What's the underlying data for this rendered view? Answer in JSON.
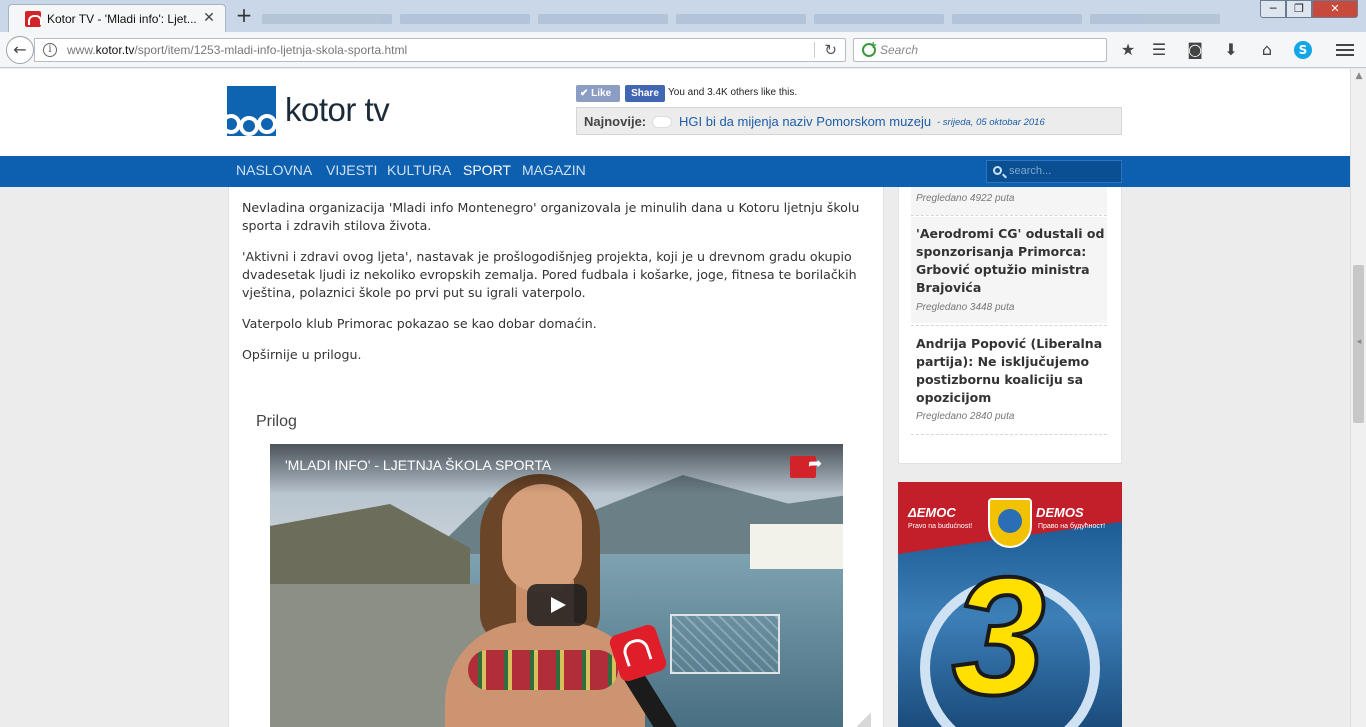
{
  "browser": {
    "tab_title": "Kotor TV - 'Mladi info': Ljet...",
    "tab_close": "✕",
    "new_tab": "+",
    "url_domain_prefix": "www.",
    "url_domain": "kotor.tv",
    "url_path": "/sport/item/1253-mladi-info-ljetnja-skola-sporta.html",
    "search_placeholder": "Search",
    "window_min": "─",
    "window_max": "❐",
    "window_close": "✕",
    "back_icon": "←",
    "info_icon": "i",
    "reload_icon": "↻",
    "toolbar_icons": [
      "★",
      "☰",
      "◙",
      "⬇",
      "⌂",
      "S"
    ]
  },
  "header": {
    "logo_text": "kotor tv",
    "fb_like": "✔ Like",
    "fb_share": "Share",
    "fb_count": "You and 3.4K others like this.",
    "ticker_label": "Najnovije:",
    "ticker_link": "HGI bi da mijenja naziv Pomorskom muzeju",
    "ticker_date": "-  srijeda, 05 oktobar 2016"
  },
  "nav": {
    "items": [
      "NASLOVNA",
      "VIJESTI",
      "KULTURA",
      "SPORT",
      "MAGAZIN"
    ],
    "active": "SPORT",
    "search_placeholder": "search..."
  },
  "article": {
    "paragraphs": [
      "Nevladina organizacija 'Mladi info Montenegro' organizovala je minulih dana u Kotoru ljetnju školu sporta i zdravih stilova života.",
      "'Aktivni i zdravi ovog ljeta', nastavak je prošlogodišnjeg projekta, koji je u drevnom gradu okupio dvadesetak ljudi iz nekoliko evropskih zemalja. Pored fudbala i košarke, joge, fitnesa te borilačkih vještina, polaznici škole po prvi put su igrali vaterpolo.",
      "Vaterpolo klub Primorac pokazao se kao dobar domaćin.",
      "Opširnije u prilogu."
    ],
    "attachment_heading": "Prilog",
    "video_title": "'MLADI INFO' - LJETNJA ŠKOLA SPORTA"
  },
  "sidebar": {
    "items": [
      {
        "title": "",
        "views": "Pregledano 4922 puta"
      },
      {
        "title": "'Aerodromi CG' odustali od sponzorisanja Primorca: Grbović optužio ministra Brajovića",
        "views": "Pregledano 3448 puta"
      },
      {
        "title": "Andrija Popović (Liberalna partija): Ne isključujemo postizbornu koaliciju sa opozicijom",
        "views": "Pregledano 2840 puta"
      }
    ]
  },
  "banner": {
    "name_left": "ΔΕΜΟС",
    "name_right": "DEMOS",
    "slogan_left": "Pravo na budućnost!",
    "slogan_right": "Право на будућност!",
    "number": "3"
  },
  "colors": {
    "nav_blue": "#0d5faf",
    "link_blue": "#1d5ea8",
    "brand_red": "#d2232a"
  }
}
